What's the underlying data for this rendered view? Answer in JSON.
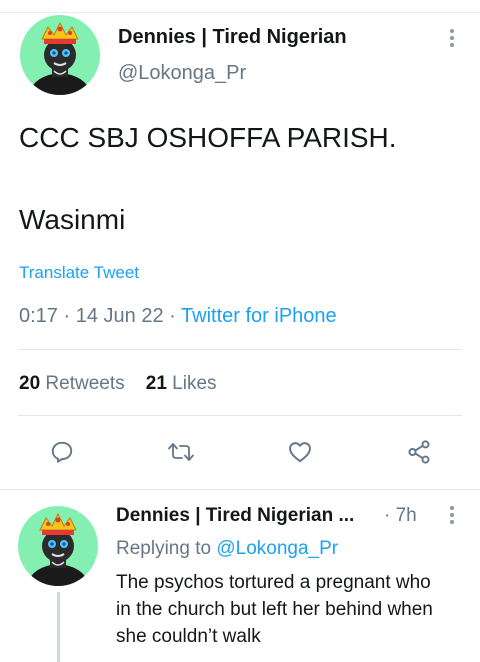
{
  "tweet": {
    "author_name": "Dennies | Tired Nigerian",
    "author_handle": "@Lokonga_Pr",
    "text_line1": "CCC SBJ OSHOFFA PARISH.",
    "text_line2": "Wasinmi",
    "translate_label": "Translate Tweet",
    "time": "0:17",
    "date": "14 Jun 22",
    "separator": "·",
    "client": "Twitter for iPhone",
    "retweets_count": "20",
    "retweets_label": "Retweets",
    "likes_count": "21",
    "likes_label": "Likes",
    "icons": {
      "more": "more-vertical-icon",
      "reply": "reply-icon",
      "retweet": "retweet-icon",
      "like": "heart-icon",
      "share": "share-icon"
    }
  },
  "reply": {
    "author_name": "Dennies | Tired Nigerian ...",
    "separator": "·",
    "time_ago": "7h",
    "replying_to_label": "Replying to",
    "replying_to_handle": "@Lokonga_Pr",
    "body": "The psychos tortured a pregnant who in the church but left her behind when she couldn’t walk"
  },
  "colors": {
    "accent": "#1da1f2",
    "secondary_text": "#657786",
    "avatar_bg": "#83f0b2",
    "divider": "#e1e8ed"
  }
}
